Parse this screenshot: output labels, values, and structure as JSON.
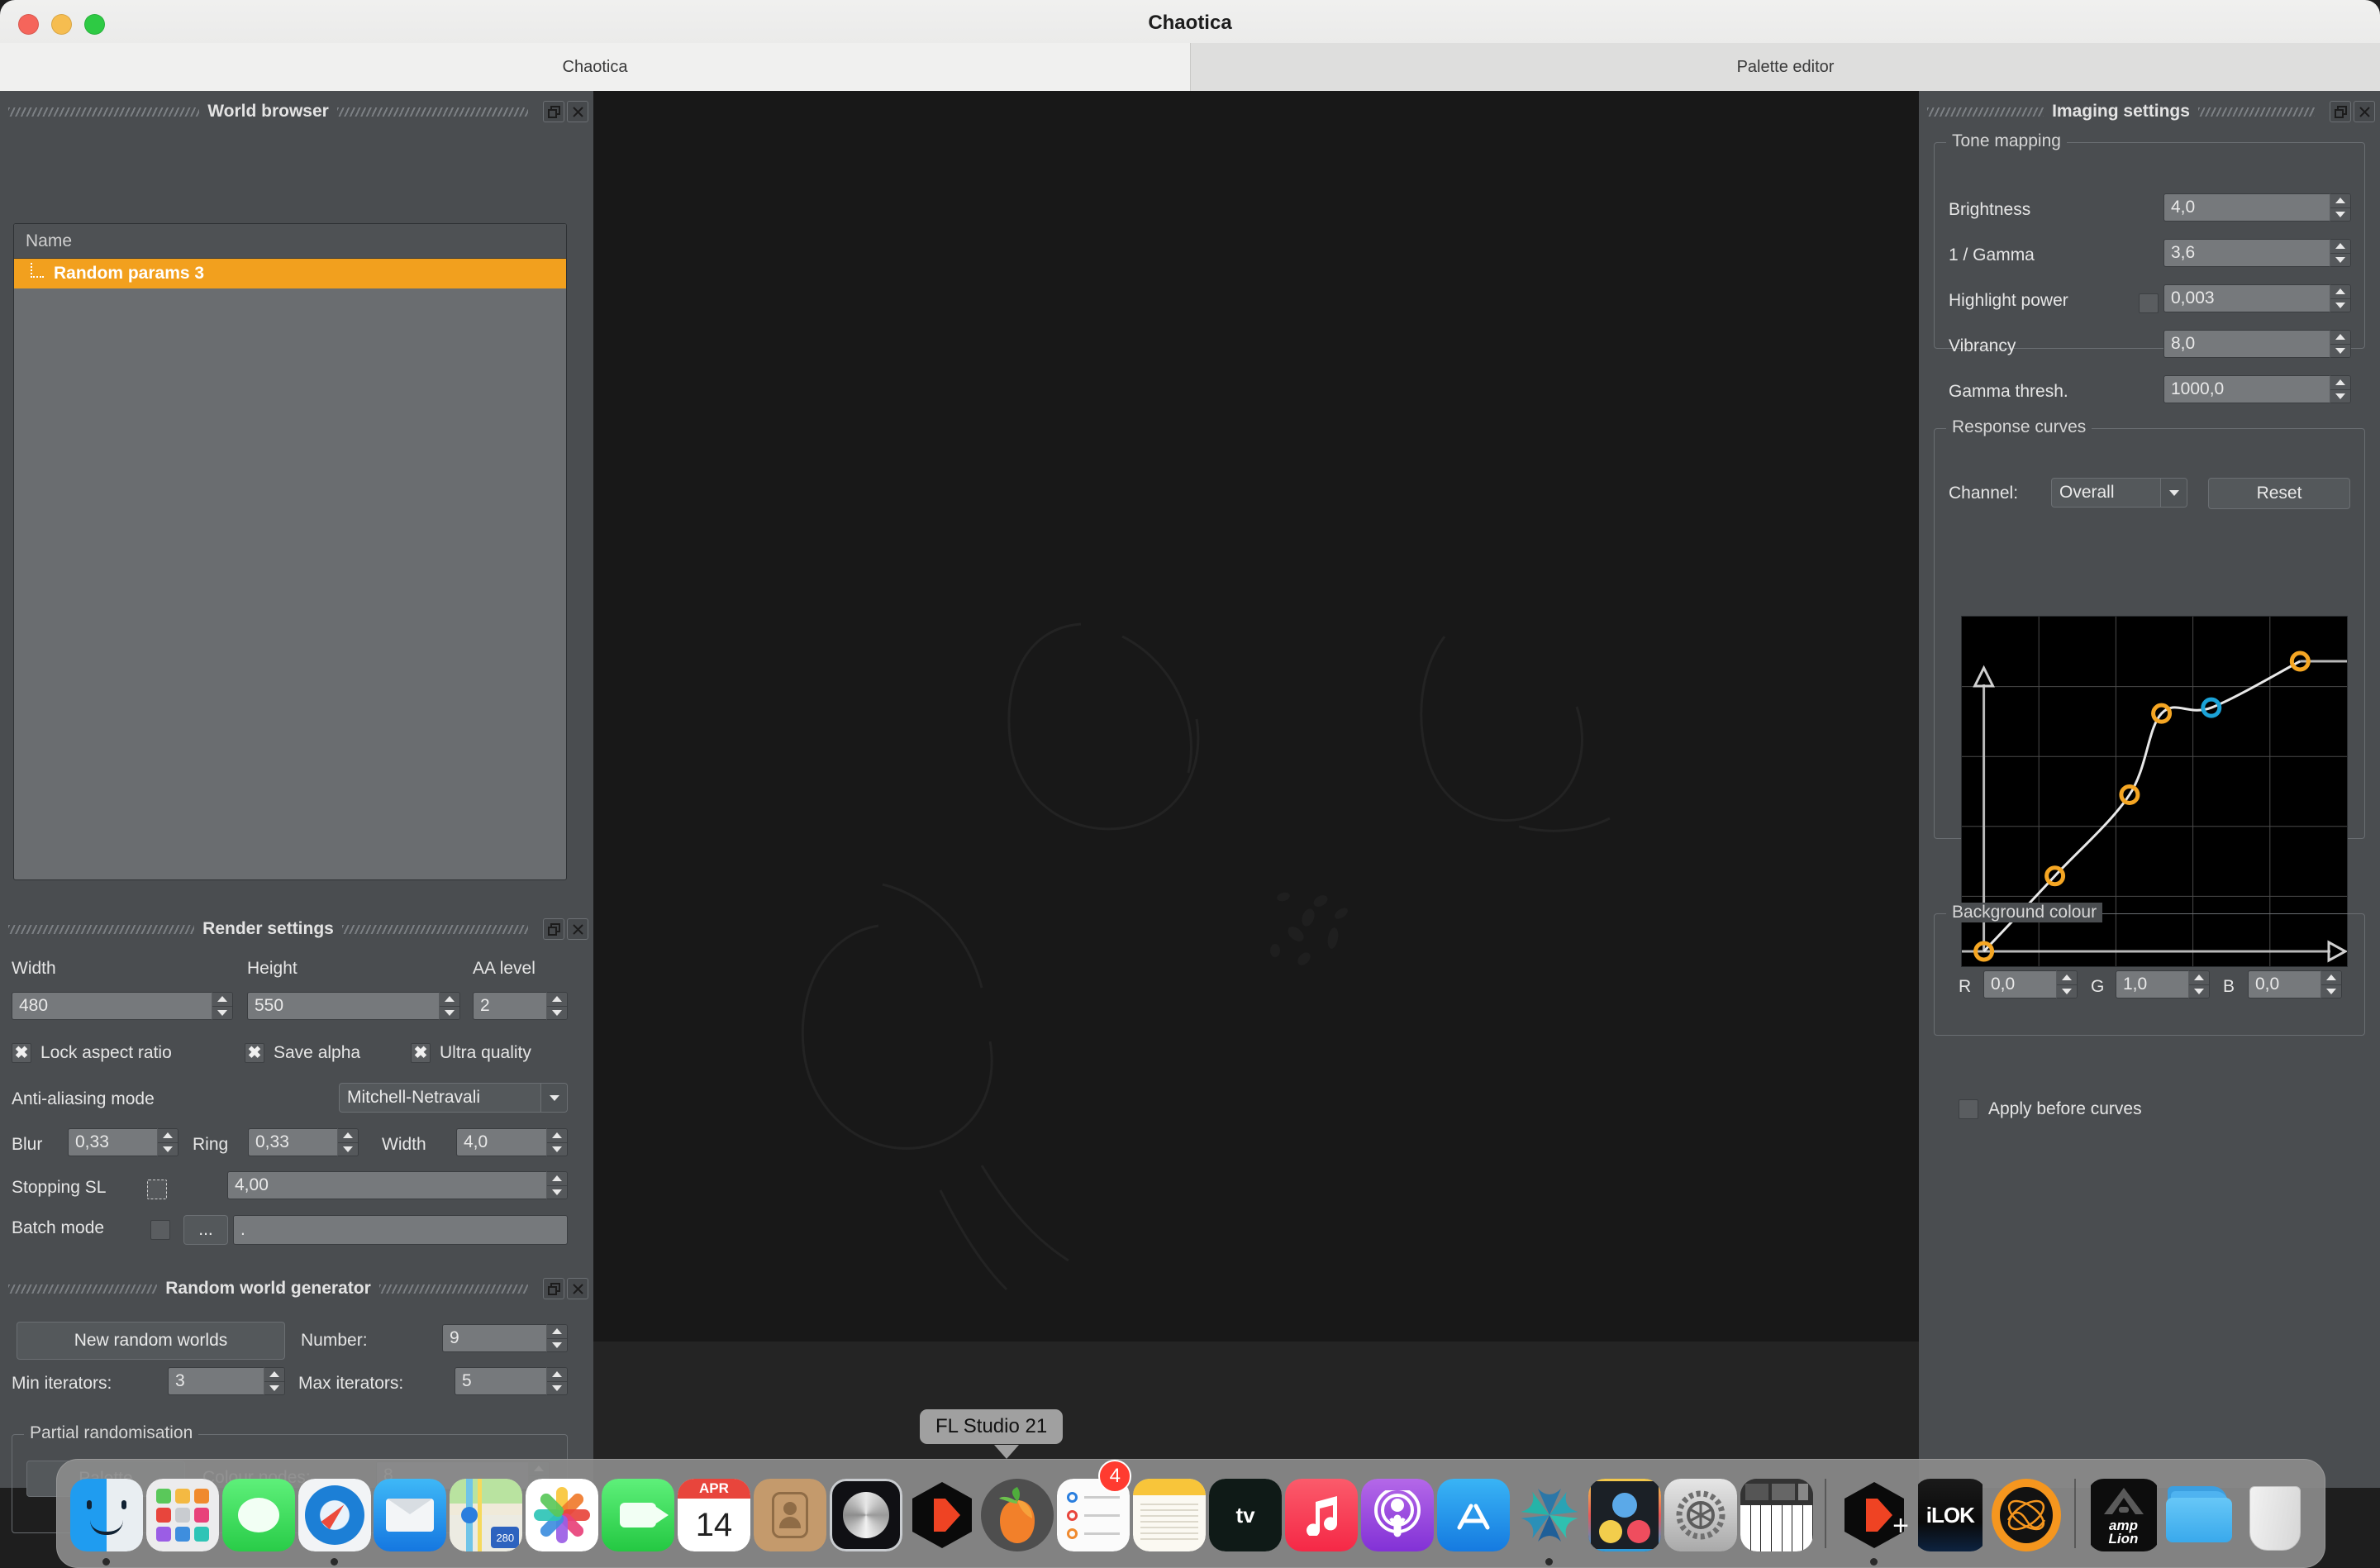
{
  "window": {
    "title": "Chaotica",
    "traffic_lights": [
      "close-red",
      "minimize-yellow",
      "zoom-green"
    ]
  },
  "tabs": [
    {
      "label": "Chaotica",
      "active": true
    },
    {
      "label": "Palette editor",
      "active": false
    }
  ],
  "world_browser": {
    "panel_title": "World browser",
    "column_header": "Name",
    "rows": [
      {
        "label": "Random params 3",
        "selected": true
      }
    ],
    "selected_color": "#f2a01e"
  },
  "render_settings": {
    "panel_title": "Render settings",
    "width_label": "Width",
    "width_value": "480",
    "height_label": "Height",
    "height_value": "550",
    "aa_level_label": "AA level",
    "aa_level_value": "2",
    "lock_aspect_label": "Lock aspect ratio",
    "lock_aspect_checked": true,
    "save_alpha_label": "Save alpha",
    "save_alpha_checked": true,
    "ultra_quality_label": "Ultra quality",
    "ultra_quality_checked": true,
    "aa_mode_label": "Anti-aliasing mode",
    "aa_mode_value": "Mitchell-Netravali",
    "blur_label": "Blur",
    "blur_value": "0,33",
    "ring_label": "Ring",
    "ring_value": "0,33",
    "filter_width_label": "Width",
    "filter_width_value": "4,0",
    "stopping_sl_label": "Stopping SL",
    "stopping_sl_checked": false,
    "stopping_sl_value": "4,00",
    "batch_mode_label": "Batch mode",
    "batch_mode_checked": false,
    "batch_browse_label": "...",
    "batch_path_value": "."
  },
  "random_world_generator": {
    "panel_title": "Random world generator",
    "new_worlds_button": "New random worlds",
    "number_label": "Number:",
    "number_value": "9",
    "min_iterators_label": "Min iterators:",
    "min_iterators_value": "3",
    "max_iterators_label": "Max iterators:",
    "max_iterators_value": "5",
    "partial_group_title": "Partial randomisation",
    "palette_button": "Palette",
    "colour_nodes_label": "Colour nodes:",
    "colour_nodes_value": "8"
  },
  "imaging_settings": {
    "panel_title": "Imaging settings",
    "tone_mapping": {
      "group_title": "Tone mapping",
      "rows": [
        {
          "label": "Brightness",
          "value": "4,0",
          "has_checkbox": false,
          "checked": false
        },
        {
          "label": "1 / Gamma",
          "value": "3,6",
          "has_checkbox": false,
          "checked": false
        },
        {
          "label": "Highlight power",
          "value": "0,003",
          "has_checkbox": true,
          "checked": false
        },
        {
          "label": "Vibrancy",
          "value": "8,0",
          "has_checkbox": false,
          "checked": false
        },
        {
          "label": "Gamma thresh.",
          "value": "1000,0",
          "has_checkbox": false,
          "checked": false
        }
      ]
    },
    "response_curves": {
      "group_title": "Response curves",
      "channel_label": "Channel:",
      "channel_value": "Overall",
      "reset_button": "Reset"
    },
    "background_colour": {
      "group_title": "Background colour",
      "r_label": "R",
      "r_value": "0,0",
      "g_label": "G",
      "g_value": "1,0",
      "b_label": "B",
      "b_value": "0,0",
      "apply_before_curves_label": "Apply before curves",
      "apply_before_curves_checked": false
    }
  },
  "chart_data": {
    "type": "line",
    "title": "Response curves",
    "xlabel": "",
    "ylabel": "",
    "xlim": [
      0,
      1
    ],
    "ylim": [
      0,
      1
    ],
    "grid": true,
    "legend": "none",
    "curve_color": "#e8e8e8",
    "node_color": "#f5a623",
    "selected_node_color": "#1ba3d8",
    "points": [
      {
        "x": 0.02,
        "y": 0.0,
        "selected": false
      },
      {
        "x": 0.22,
        "y": 0.26,
        "selected": false
      },
      {
        "x": 0.43,
        "y": 0.54,
        "selected": false
      },
      {
        "x": 0.52,
        "y": 0.82,
        "selected": false
      },
      {
        "x": 0.66,
        "y": 0.84,
        "selected": true
      },
      {
        "x": 0.91,
        "y": 1.0,
        "selected": false
      }
    ]
  },
  "tooltip": {
    "text": "FL Studio 21"
  },
  "dock": {
    "items": [
      {
        "name": "finder",
        "label": "Finder",
        "running": true
      },
      {
        "name": "launchpad",
        "label": "Launchpad",
        "running": false
      },
      {
        "name": "messages",
        "label": "Messages",
        "running": false
      },
      {
        "name": "safari",
        "label": "Safari",
        "running": true
      },
      {
        "name": "mail",
        "label": "Mail",
        "running": false
      },
      {
        "name": "maps",
        "label": "Maps",
        "running": false
      },
      {
        "name": "photos",
        "label": "Photos",
        "running": false
      },
      {
        "name": "facetime",
        "label": "FaceTime",
        "running": false
      },
      {
        "name": "calendar",
        "label": "APR 14",
        "running": false
      },
      {
        "name": "contacts",
        "label": "Contacts",
        "running": false
      },
      {
        "name": "logic-pro",
        "label": "Logic Pro",
        "running": false
      },
      {
        "name": "cinema-4d",
        "label": "Cinema 4D",
        "running": false
      },
      {
        "name": "fl-studio",
        "label": "FL Studio 21",
        "running": false
      },
      {
        "name": "reminders",
        "label": "Reminders",
        "running": false,
        "badge": "4"
      },
      {
        "name": "notes",
        "label": "Notes",
        "running": false
      },
      {
        "name": "apple-tv",
        "label": "Apple TV",
        "running": false
      },
      {
        "name": "music",
        "label": "Music",
        "running": false
      },
      {
        "name": "podcasts",
        "label": "Podcasts",
        "running": false
      },
      {
        "name": "app-store",
        "label": "App Store",
        "running": false
      },
      {
        "name": "chaotica",
        "label": "Chaotica",
        "running": true
      },
      {
        "name": "davinci-resolve",
        "label": "DaVinci Resolve",
        "running": false
      },
      {
        "name": "system-settings",
        "label": "System Settings",
        "running": false
      },
      {
        "name": "audio-midi-setup",
        "label": "Audio MIDI Setup",
        "running": false
      },
      {
        "name": "separator-1",
        "label": "",
        "running": false
      },
      {
        "name": "cinema-4d-plus",
        "label": "Cinema 4D",
        "running": true
      },
      {
        "name": "ilok",
        "label": "iLok",
        "running": false
      },
      {
        "name": "serum",
        "label": "Serum",
        "running": false
      },
      {
        "name": "separator-2",
        "label": "",
        "running": false
      },
      {
        "name": "amplion",
        "label": "Amplion",
        "running": false
      },
      {
        "name": "downloads",
        "label": "Downloads",
        "running": false
      },
      {
        "name": "trash",
        "label": "Trash",
        "running": false
      }
    ],
    "calendar_month": "APR",
    "calendar_day": "14"
  }
}
